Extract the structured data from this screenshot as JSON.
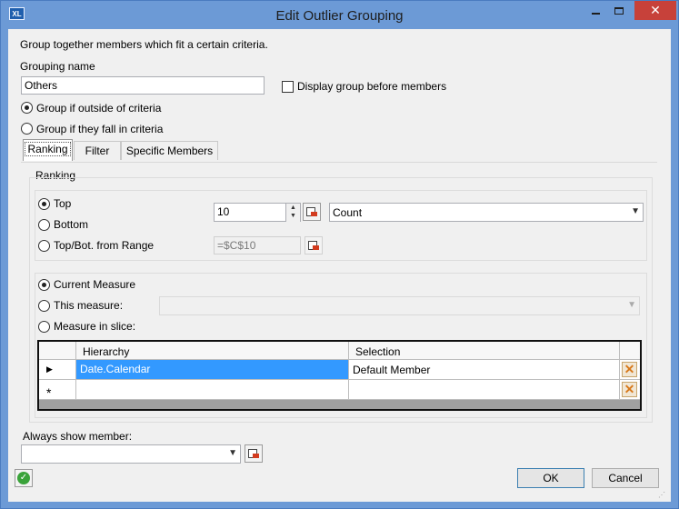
{
  "window": {
    "app_icon_text": "XL",
    "title": "Edit Outlier Grouping",
    "close_glyph": "✕"
  },
  "intro_text": "Group together members which fit a certain criteria.",
  "grouping_name": {
    "label": "Grouping name",
    "value": "Others"
  },
  "display_group_before_members": {
    "label": "Display group before members",
    "checked": false
  },
  "group_mode": {
    "options": [
      "Group if outside of criteria",
      "Group if they fall in criteria"
    ],
    "selected": "Group if outside of criteria"
  },
  "tabs": [
    {
      "label": "Ranking",
      "active": true
    },
    {
      "label": "Filter",
      "active": false
    },
    {
      "label": "Specific Members",
      "active": false
    }
  ],
  "ranking": {
    "group_label": "Ranking",
    "rank_options": [
      "Top",
      "Bottom",
      "Top/Bot. from Range"
    ],
    "rank_selected": "Top",
    "count_value": "10",
    "measure_by": "Count",
    "range_value": "=$C$10",
    "measure_options": [
      "Current Measure",
      "This measure:",
      "Measure in slice:"
    ],
    "measure_selected": "Current Measure",
    "this_measure_value": ""
  },
  "slice_grid": {
    "columns": [
      "Hierarchy",
      "Selection"
    ],
    "rows": [
      {
        "hierarchy": "Date.Calendar",
        "selection": "Default Member"
      }
    ],
    "current_row_marker": "▶",
    "new_row_marker": "*",
    "delete_glyph": "✕"
  },
  "always_show_member": {
    "label": "Always show member:",
    "value": ""
  },
  "footer": {
    "help_icon_glyph": "✓",
    "ok_label": "OK",
    "cancel_label": "Cancel"
  },
  "colors": {
    "title_bar": "#6c9ad6",
    "close_button": "#c7413a",
    "selection_highlight": "#3399ff",
    "dialog_background": "#f0f0f0"
  }
}
